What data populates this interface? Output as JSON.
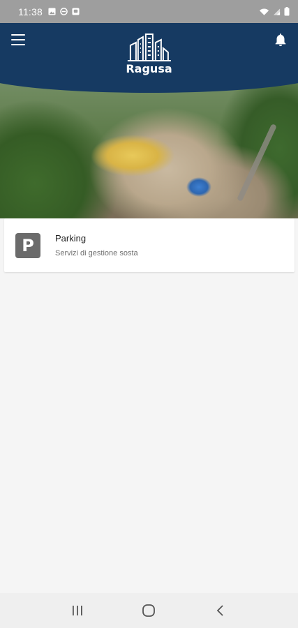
{
  "status_bar": {
    "time": "11:38",
    "left_icons": [
      "image-icon",
      "minus-circle-icon",
      "app-notification-icon"
    ],
    "right_icons": [
      "wifi-icon",
      "signal-icon",
      "battery-icon"
    ]
  },
  "header": {
    "app_name": "Ragusa",
    "menu_icon": "hamburger-menu-icon",
    "notification_icon": "bell-icon",
    "logo_icon": "city-buildings-icon",
    "brand_color": "#163a62"
  },
  "services": [
    {
      "icon_letter": "P",
      "icon_name": "parking-icon",
      "title": "Parking",
      "subtitle": "Servizi di gestione sosta"
    }
  ],
  "nav_bar": {
    "recent_icon": "recent-apps-icon",
    "home_icon": "home-icon",
    "back_icon": "back-icon"
  }
}
